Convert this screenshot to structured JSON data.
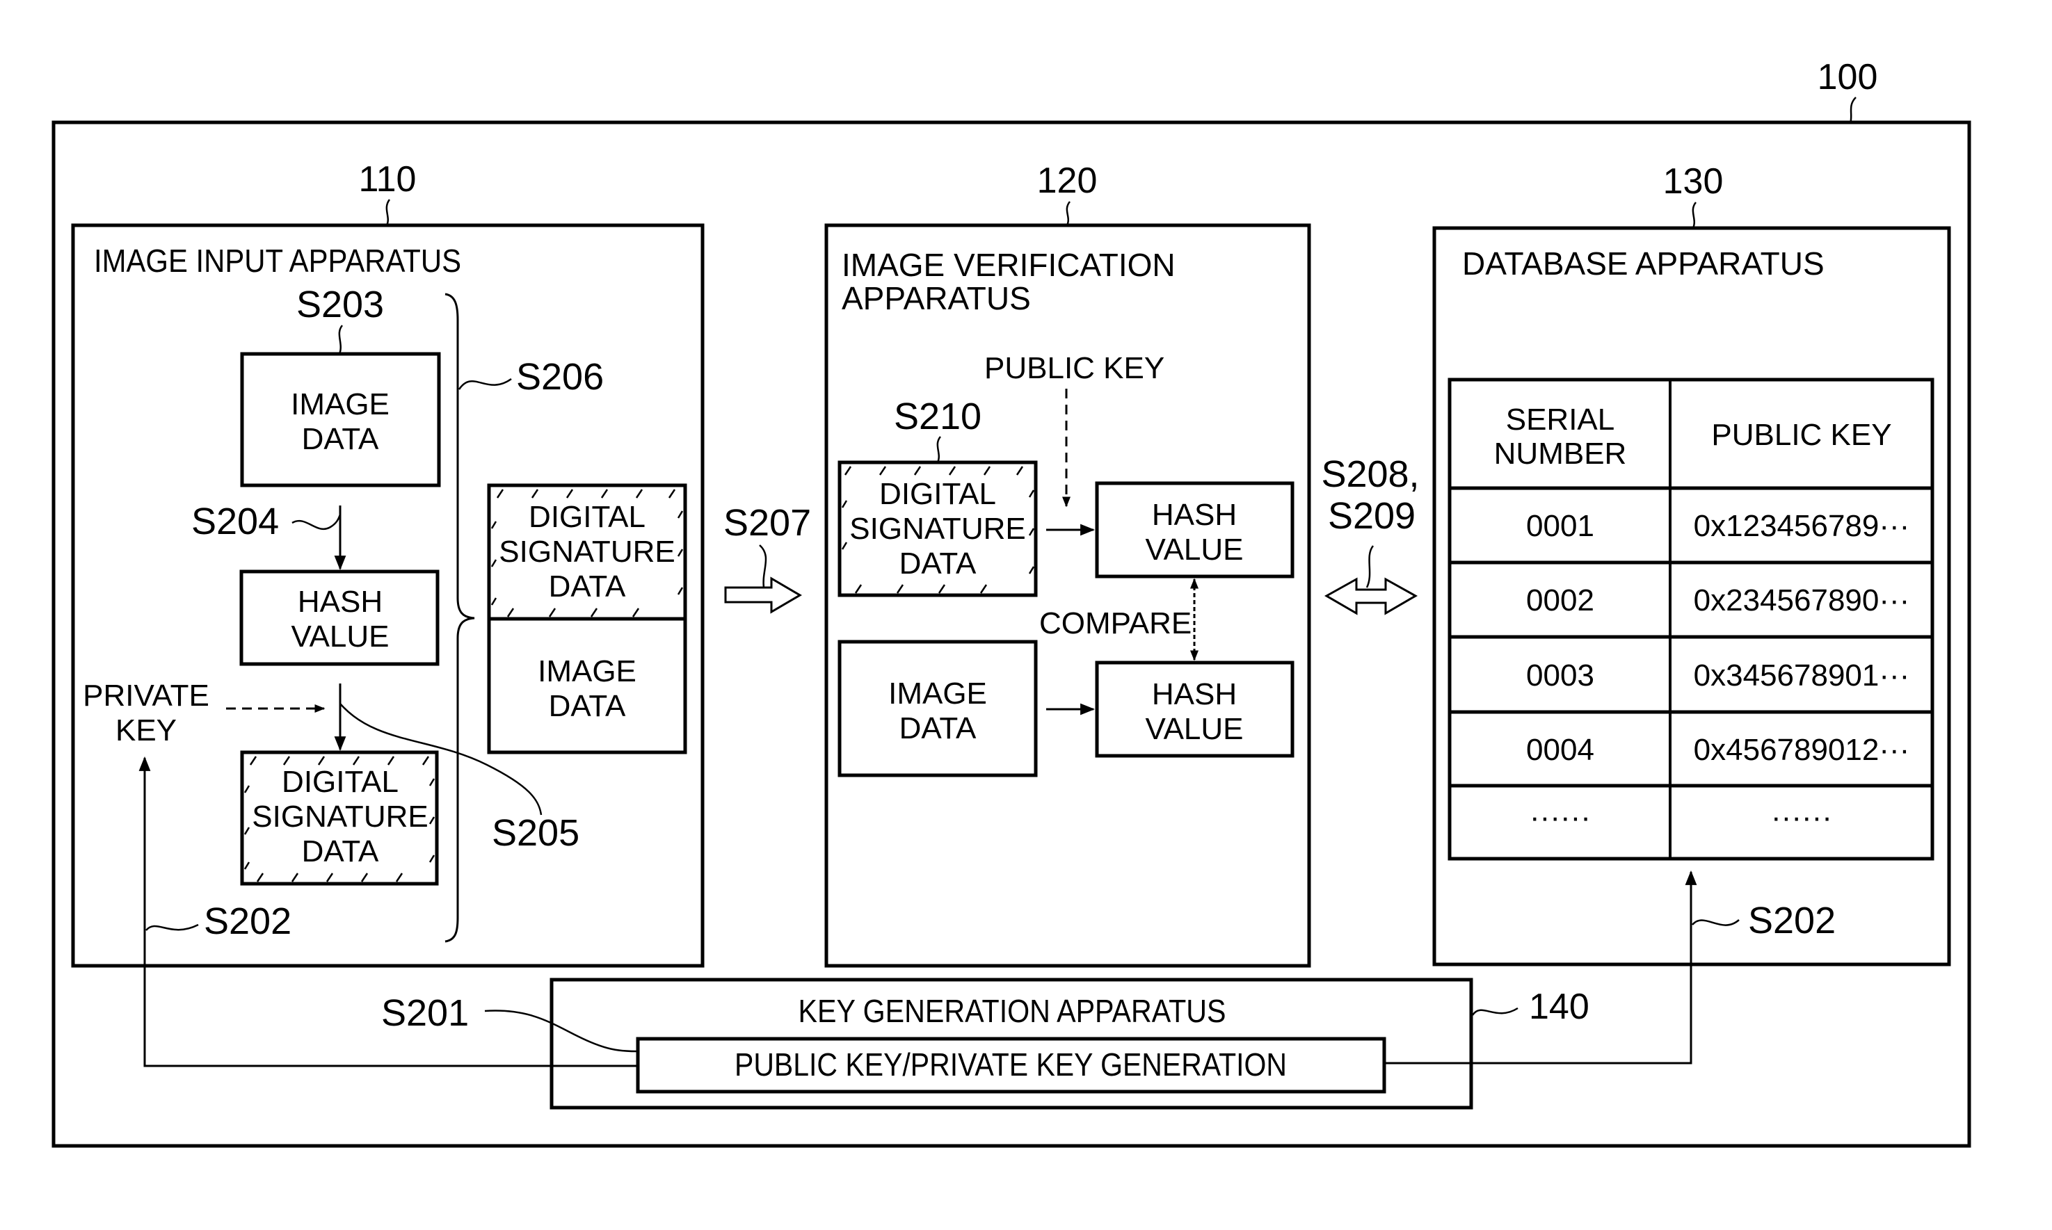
{
  "figure": {
    "system_ref": "100",
    "image_input": {
      "ref": "110",
      "title": "IMAGE INPUT APPARATUS",
      "image_data": [
        "IMAGE",
        "DATA"
      ],
      "hash_value": [
        "HASH",
        "VALUE"
      ],
      "signature": [
        "DIGITAL",
        "SIGNATURE",
        "DATA"
      ],
      "private_key": [
        "PRIVATE",
        "KEY"
      ],
      "bundle_signature": [
        "DIGITAL",
        "SIGNATURE",
        "DATA"
      ],
      "bundle_image": [
        "IMAGE",
        "DATA"
      ],
      "steps": {
        "s203": "S203",
        "s204": "S204",
        "s205": "S205",
        "s206": "S206",
        "s202": "S202"
      }
    },
    "transfer": {
      "s207": "S207",
      "s208_209_line1": "S208,",
      "s208_209_line2": "S209"
    },
    "verification": {
      "ref": "120",
      "title": [
        "IMAGE VERIFICATION",
        "APPARATUS"
      ],
      "public_key": "PUBLIC KEY",
      "step_s210": "S210",
      "signature": [
        "DIGITAL",
        "SIGNATURE",
        "DATA"
      ],
      "image_data": [
        "IMAGE",
        "DATA"
      ],
      "hash_top": [
        "HASH",
        "VALUE"
      ],
      "hash_bottom": [
        "HASH",
        "VALUE"
      ],
      "compare": "COMPARE"
    },
    "database": {
      "ref": "130",
      "title": "DATABASE APPARATUS",
      "step_s202": "S202",
      "table": {
        "headers": [
          [
            "SERIAL",
            "NUMBER"
          ],
          [
            "PUBLIC KEY"
          ]
        ],
        "rows": [
          [
            "0001",
            "0x123456789···"
          ],
          [
            "0002",
            "0x234567890···"
          ],
          [
            "0003",
            "0x345678901···"
          ],
          [
            "0004",
            "0x456789012···"
          ],
          [
            "······",
            "······"
          ]
        ]
      }
    },
    "key_generation": {
      "ref": "140",
      "title": "KEY GENERATION APPARATUS",
      "process": "PUBLIC KEY/PRIVATE KEY GENERATION",
      "step_s201": "S201"
    }
  }
}
